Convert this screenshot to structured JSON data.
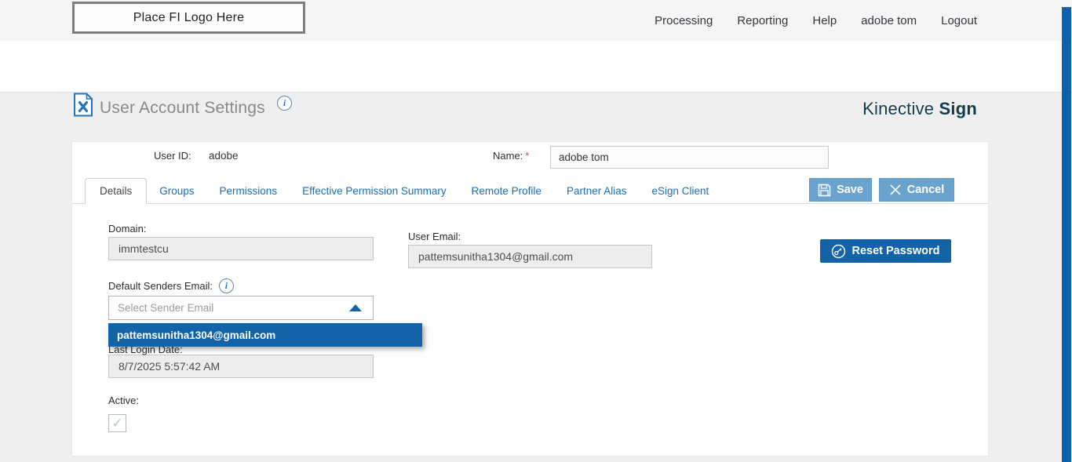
{
  "topbar": {
    "logo_placeholder": "Place FI Logo Here",
    "nav": [
      {
        "label": "Processing"
      },
      {
        "label": "Reporting"
      },
      {
        "label": "Help"
      },
      {
        "label": "adobe tom"
      },
      {
        "label": "Logout"
      }
    ]
  },
  "header": {
    "title": "User Account Settings",
    "info_icon": "i",
    "brand": {
      "regular": "Kinective",
      "bold": "Sign"
    }
  },
  "account": {
    "user_id_label": "User ID:",
    "user_id_value": "adobe",
    "name_label": "Name:",
    "required_marker": "*",
    "name_value": "adobe tom"
  },
  "tabs": [
    {
      "label": "Details",
      "active": true
    },
    {
      "label": "Groups",
      "active": false
    },
    {
      "label": "Permissions",
      "active": false
    },
    {
      "label": "Effective Permission Summary",
      "active": false
    },
    {
      "label": "Remote Profile",
      "active": false
    },
    {
      "label": "Partner Alias",
      "active": false
    },
    {
      "label": "eSign Client",
      "active": false
    }
  ],
  "actions": {
    "save_label": "Save",
    "cancel_label": "Cancel",
    "reset_password_label": "Reset Password"
  },
  "details": {
    "domain_label": "Domain:",
    "domain_value": "immtestcu",
    "user_email_label": "User Email:",
    "user_email_value": "pattemsunitha1304@gmail.com",
    "default_senders_label": "Default Senders Email:",
    "sender_select_placeholder": "Select Sender Email",
    "sender_options": [
      "pattemsunitha1304@gmail.com"
    ],
    "last_login_label": "Last Login Date:",
    "last_login_value": "8/7/2025 5:57:42 AM",
    "active_label": "Active:",
    "active_checked": true,
    "checkmark": "✓"
  },
  "colors": {
    "accent_blue": "#1263a8",
    "steel_blue": "#6ba3cf",
    "tab_link_blue": "#1a6eb3",
    "brand_navy": "#123c50",
    "scrollbar_blue": "#0d63ab",
    "required_red": "#e23b3b",
    "icon_blue": "#2176bd"
  }
}
